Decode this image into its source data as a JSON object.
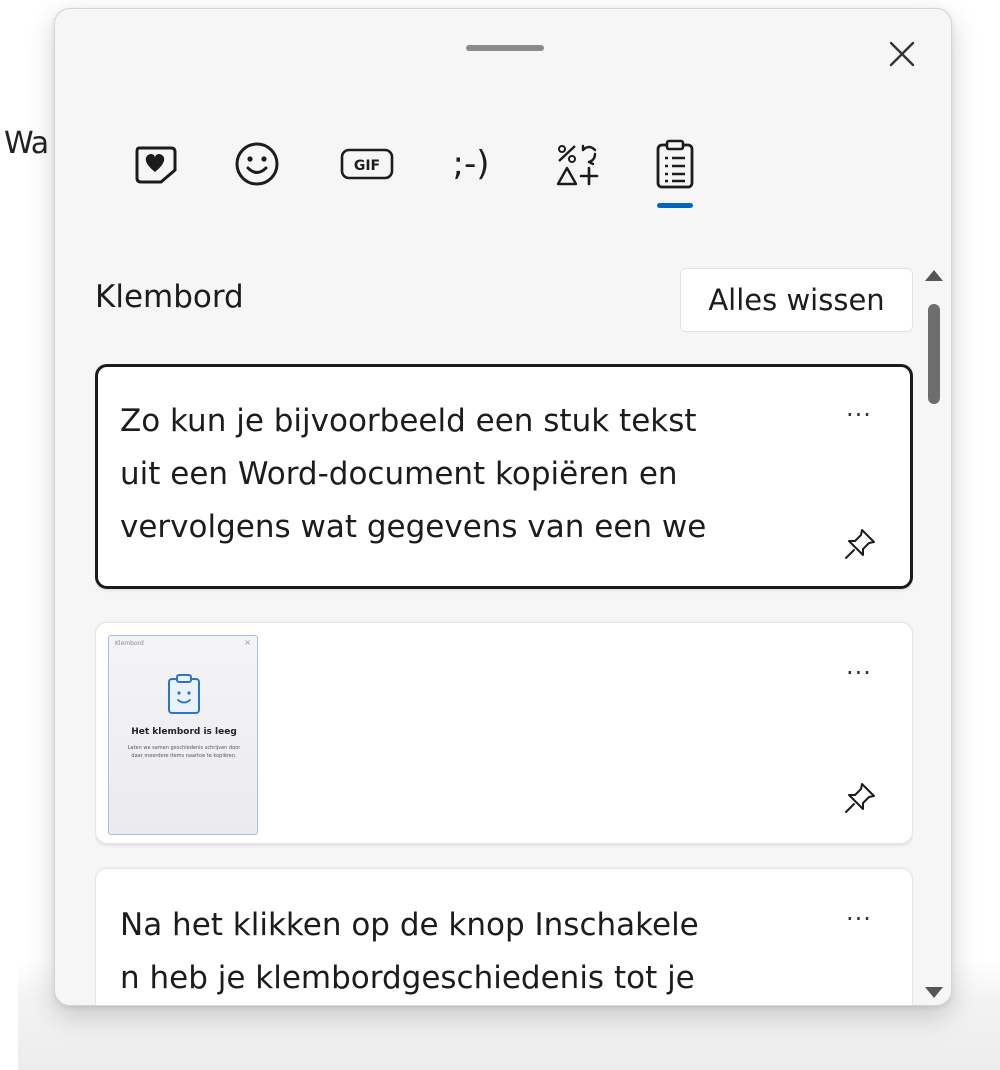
{
  "background": {
    "partial_text": "Wa"
  },
  "panel": {
    "tabs": [
      {
        "name": "kaomoji-favorites",
        "icon": "heart-sticker-icon",
        "label": ""
      },
      {
        "name": "emoji",
        "icon": "smiley-icon",
        "label": ""
      },
      {
        "name": "gif",
        "icon": "gif-icon",
        "label": "GIF"
      },
      {
        "name": "kaomoji",
        "icon": "kaomoji-icon",
        "label": ";-)"
      },
      {
        "name": "symbols",
        "icon": "symbols-icon",
        "label": ""
      },
      {
        "name": "clipboard",
        "icon": "clipboard-icon",
        "label": "",
        "selected": true
      }
    ],
    "clipboard": {
      "title": "Klembord",
      "clear_all_label": "Alles wissen",
      "more_label": "···",
      "items": [
        {
          "type": "text",
          "lines": [
            "Zo kun je bijvoorbeeld een stuk tekst",
            "uit een Word-document kopiëren en",
            "vervolgens wat gegevens van een we"
          ]
        },
        {
          "type": "image",
          "thumbnail": {
            "title": "Klembord",
            "close": "×",
            "heading": "Het klembord is leeg",
            "description": "Laten we samen geschiedenis schrijven door daar meerdere items naartoe te kopiëren."
          }
        },
        {
          "type": "text",
          "lines": [
            "Na het klikken op de knop Inschakele",
            "n heb je klembordgeschiedenis tot je"
          ]
        }
      ]
    }
  },
  "colors": {
    "accent": "#0067c0",
    "selected_border": "#1b1b1b",
    "panel_bg": "#f6f6f6"
  }
}
